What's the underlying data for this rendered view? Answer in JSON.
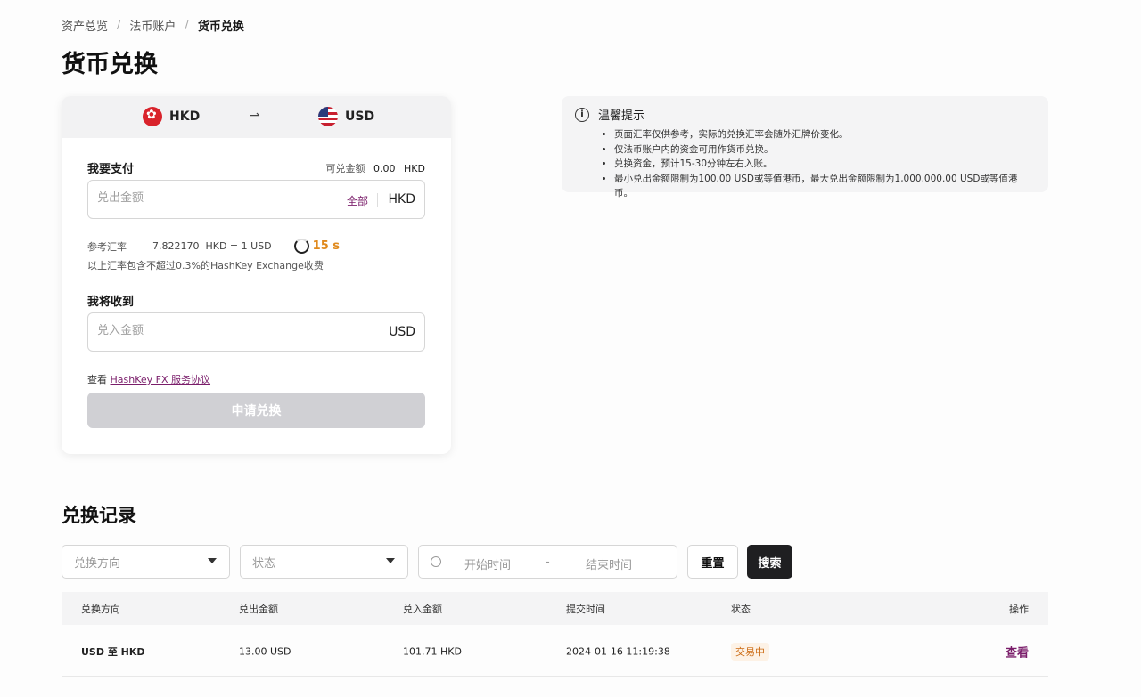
{
  "breadcrumb": [
    "资产总览",
    "法币账户",
    "货币兑换"
  ],
  "page_title": "货币兑换",
  "exchange": {
    "from_currency": "HKD",
    "to_currency": "USD",
    "arrow": "⇀",
    "pay_label": "我要支付",
    "available_label": "可兑金额",
    "available_value": "0.00",
    "available_unit": "HKD",
    "pay_placeholder": "兑出金额",
    "all_label": "全部",
    "pay_unit": "HKD",
    "rate_label": "参考汇率",
    "rate_value": "7.822170  HKD = 1 USD",
    "countdown": "15 s",
    "fee_note": "以上汇率包含不超过0.3%的HashKey Exchange收费",
    "receive_label": "我将收到",
    "receive_placeholder": "兑入金额",
    "receive_unit": "USD",
    "agreement_prefix": "查看",
    "agreement_link": "HashKey FX 服务协议",
    "submit_label": "申请兑换"
  },
  "notice": {
    "title": "温馨提示",
    "items": [
      "页面汇率仅供参考，实际的兑换汇率会随外汇牌价变化。",
      "仅法币账户内的资金可用作货币兑换。",
      "兑换资金，预计15-30分钟左右入账。",
      "最小兑出金额限制为100.00 USD或等值港币，最大兑出金额限制为1,000,000.00 USD或等值港币。"
    ]
  },
  "records": {
    "title": "兑换记录",
    "filters": {
      "direction_placeholder": "兑换方向",
      "status_placeholder": "状态",
      "start_placeholder": "开始时间",
      "range_sep": "-",
      "end_placeholder": "结束时间"
    },
    "reset_label": "重置",
    "search_label": "搜索",
    "columns": [
      "兑换方向",
      "兑出金额",
      "兑入金额",
      "提交时间",
      "状态",
      "操作"
    ],
    "rows": [
      {
        "direction": "USD 至 HKD",
        "out_amount": "13.00 USD",
        "in_amount": "101.71 HKD",
        "time": "2024-01-16 11:19:38",
        "status": "交易中",
        "action": "查看"
      }
    ]
  },
  "colors": {
    "accent": "#7a1d6a",
    "pending": "#cc6a12",
    "countdown": "#e08a1e"
  }
}
